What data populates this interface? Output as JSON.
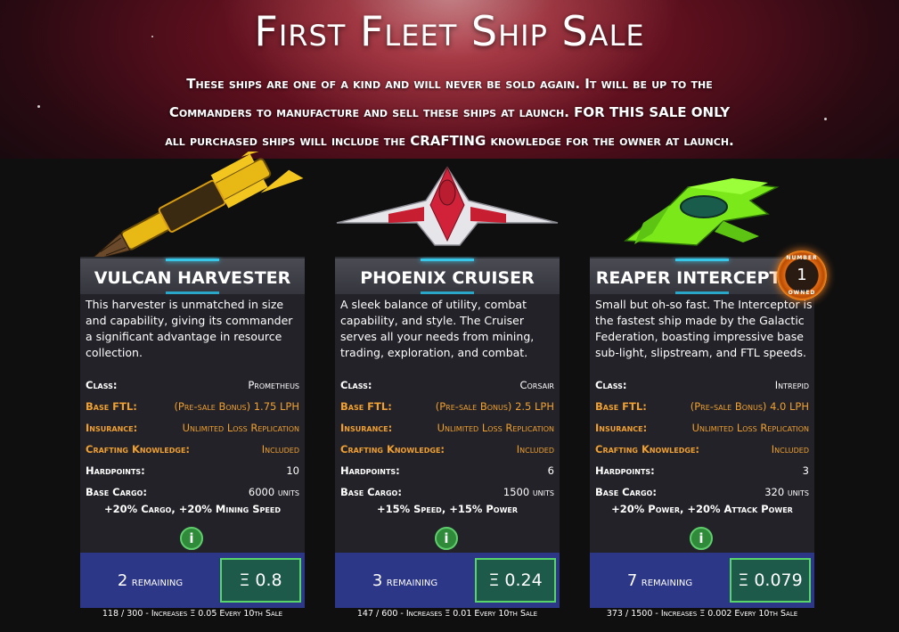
{
  "hero": {
    "title": "First Fleet Ship Sale",
    "subtitle_line1": "These ships are one of a kind and will never be sold again. It will be up to the",
    "subtitle_line2": "Commanders to manufacture and sell these ships at launch. FOR THIS SALE ONLY",
    "subtitle_line3": "all purchased ships will include the CRAFTING knowledge for the owner at launch."
  },
  "labels": {
    "class": "Class:",
    "ftl": "Base FTL:",
    "insurance": "Insurance:",
    "crafting": "Crafting Knowledge:",
    "hardpoints": "Hardpoints:",
    "cargo": "Base Cargo:",
    "remaining": "remaining",
    "info": "i"
  },
  "colors": {
    "accent_orange": "#f0a030",
    "footer_blue": "#2d3787",
    "price_green": "#58d56a"
  },
  "ships": [
    {
      "name": "VULCAN HARVESTER",
      "icon": "yellow-harvester-ship",
      "description": "This harvester is unmatched in size and capability, giving its commander a significant advantage in resource collection.",
      "class": "Prometheus",
      "ftl": "(Pre-sale Bonus) 1.75 LPH",
      "insurance": "Unlimited Loss Replication",
      "crafting": "Included",
      "hardpoints": "10",
      "cargo": "6000 units",
      "bonus": "+20% Cargo, +20% Mining Speed",
      "remaining": "2",
      "price": "Ξ 0.8",
      "note": "118 / 300 - Increases Ξ 0.05 Every 10th Sale"
    },
    {
      "name": "PHOENIX CRUISER",
      "icon": "red-white-cruiser-ship",
      "description": "A sleek balance of utility, combat capability, and style. The Cruiser serves all your needs from mining, trading, exploration, and combat.",
      "class": "Corsair",
      "ftl": "(Pre-sale Bonus) 2.5 LPH",
      "insurance": "Unlimited Loss Replication",
      "crafting": "Included",
      "hardpoints": "6",
      "cargo": "1500 units",
      "bonus": "+15% Speed, +15% Power",
      "remaining": "3",
      "price": "Ξ 0.24",
      "note": "147 / 600 - Increases Ξ 0.01 Every 10th Sale"
    },
    {
      "name": "REAPER INTERCEPTOR",
      "icon": "green-interceptor-ship",
      "description": "Small but oh-so fast. The Interceptor is the fastest ship made by the Galactic Federation, boasting impressive base sub-light, slipstream, and FTL speeds.",
      "class": "Intrepid",
      "ftl": "(Pre-sale Bonus) 4.0 LPH",
      "insurance": "Unlimited Loss Replication",
      "crafting": "Included",
      "hardpoints": "3",
      "cargo": "320 units",
      "bonus": "+20% Power, +20% Attack Power",
      "remaining": "7",
      "price": "Ξ 0.079",
      "note": "373 / 1500 - Increases Ξ 0.002 Every 10th Sale",
      "badge": {
        "number": "1",
        "top_text": "NUMBER",
        "bottom_text": "OWNED"
      }
    }
  ]
}
